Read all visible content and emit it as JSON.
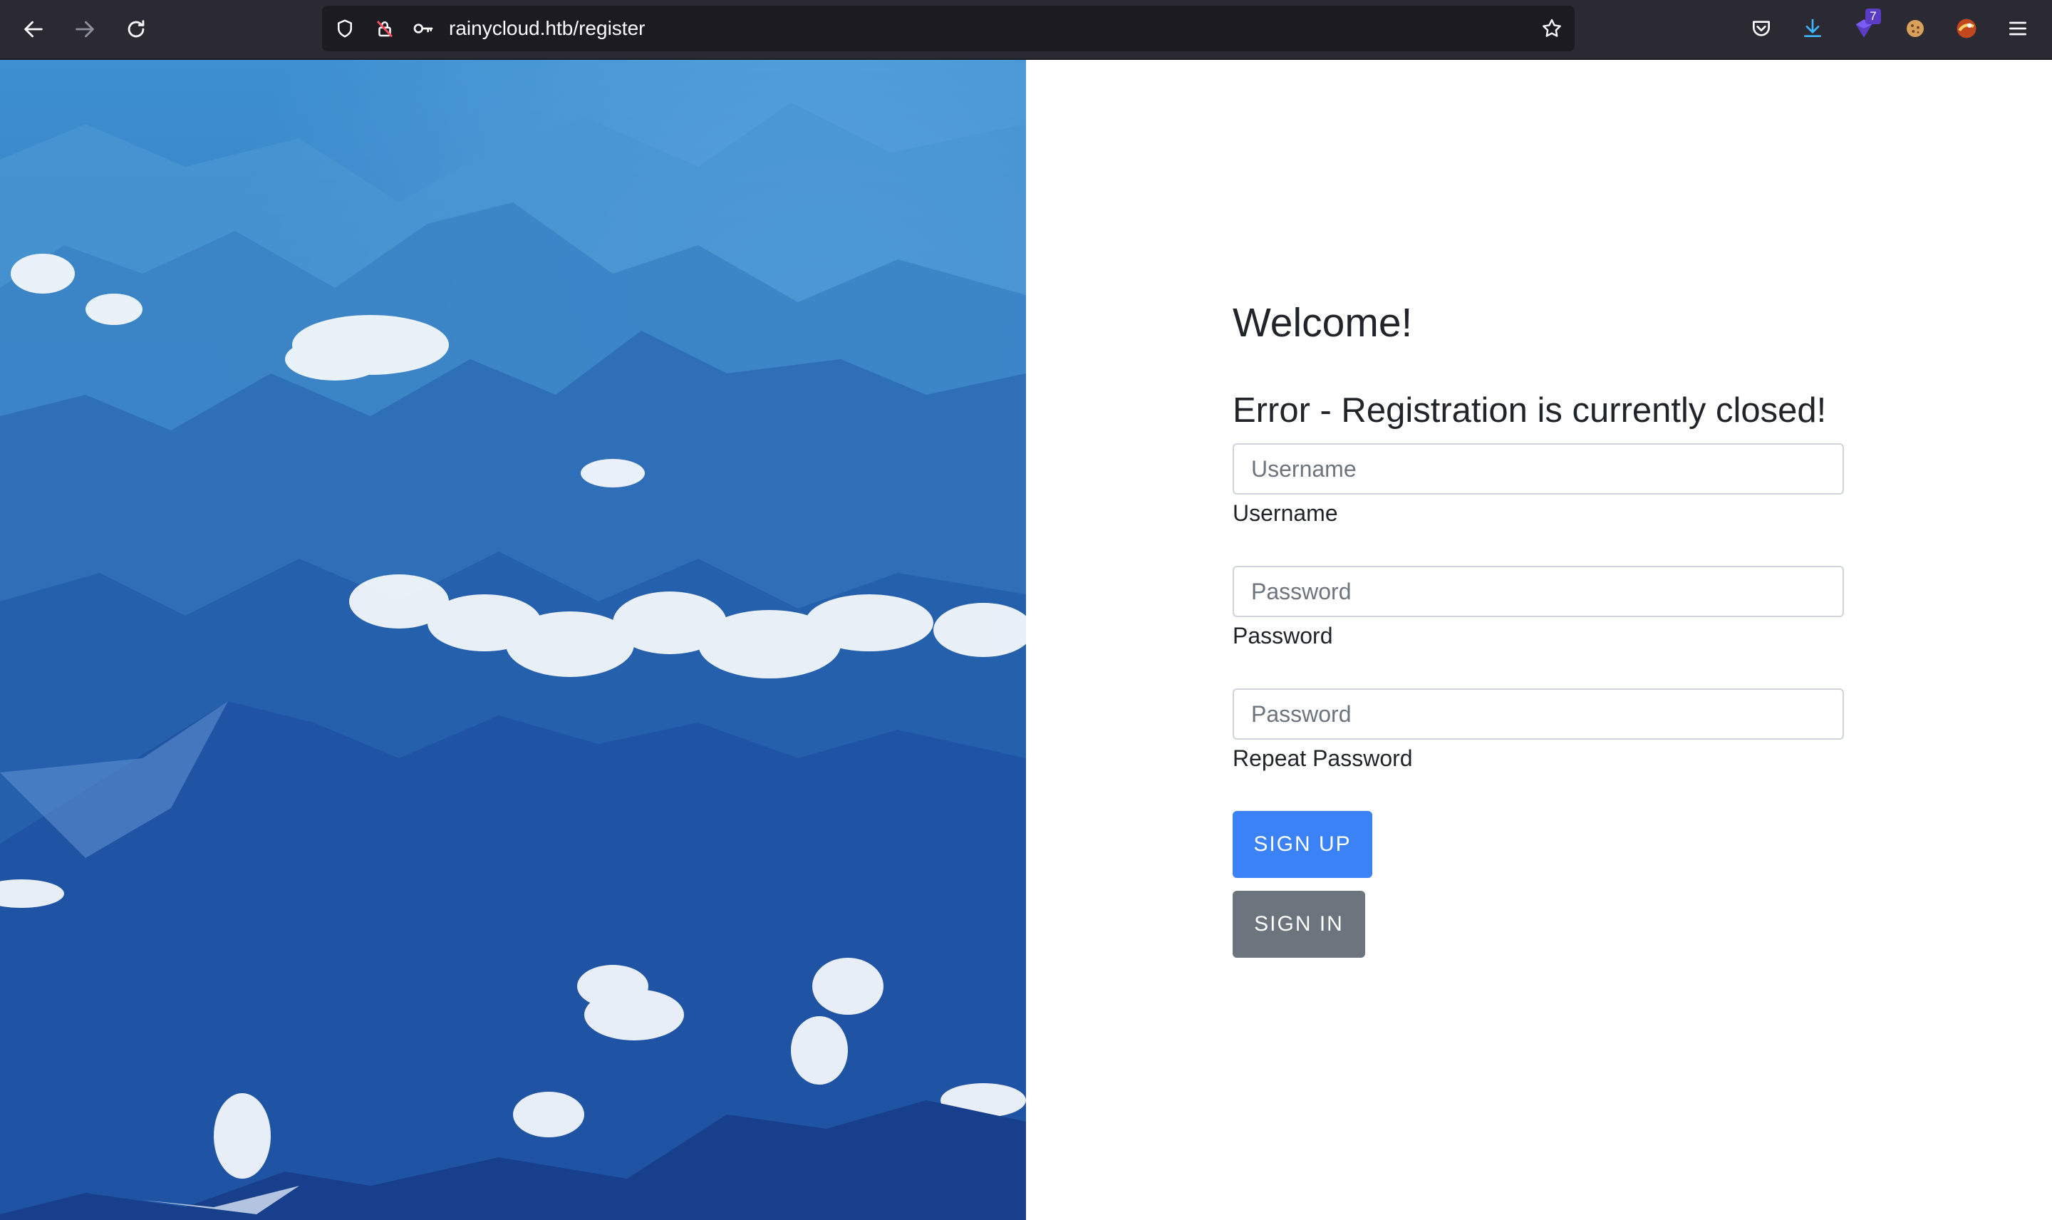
{
  "browser": {
    "url": "rainycloud.htb/register",
    "extensions_badge": "7",
    "icons": [
      "back-arrow-icon",
      "forward-arrow-icon",
      "reload-icon",
      "shield-icon",
      "insecure-lock-icon",
      "key-icon",
      "bookmark-star-icon",
      "pocket-icon",
      "download-icon",
      "extension-icon",
      "cookie-icon",
      "avatar-icon",
      "menu-icon"
    ]
  },
  "page": {
    "welcome": "Welcome!",
    "error": "Error - Registration is currently closed!",
    "username": {
      "placeholder": "Username",
      "label": "Username"
    },
    "password": {
      "placeholder": "Password",
      "label": "Password"
    },
    "repeat_password": {
      "placeholder": "Password",
      "label": "Repeat Password"
    },
    "signup_label": "SIGN UP",
    "signin_label": "SIGN IN"
  },
  "colors": {
    "primary": "#3b82f6",
    "secondary": "#6c757d",
    "toolbar": "#2b2a33",
    "sky": "#1e4fa3"
  }
}
